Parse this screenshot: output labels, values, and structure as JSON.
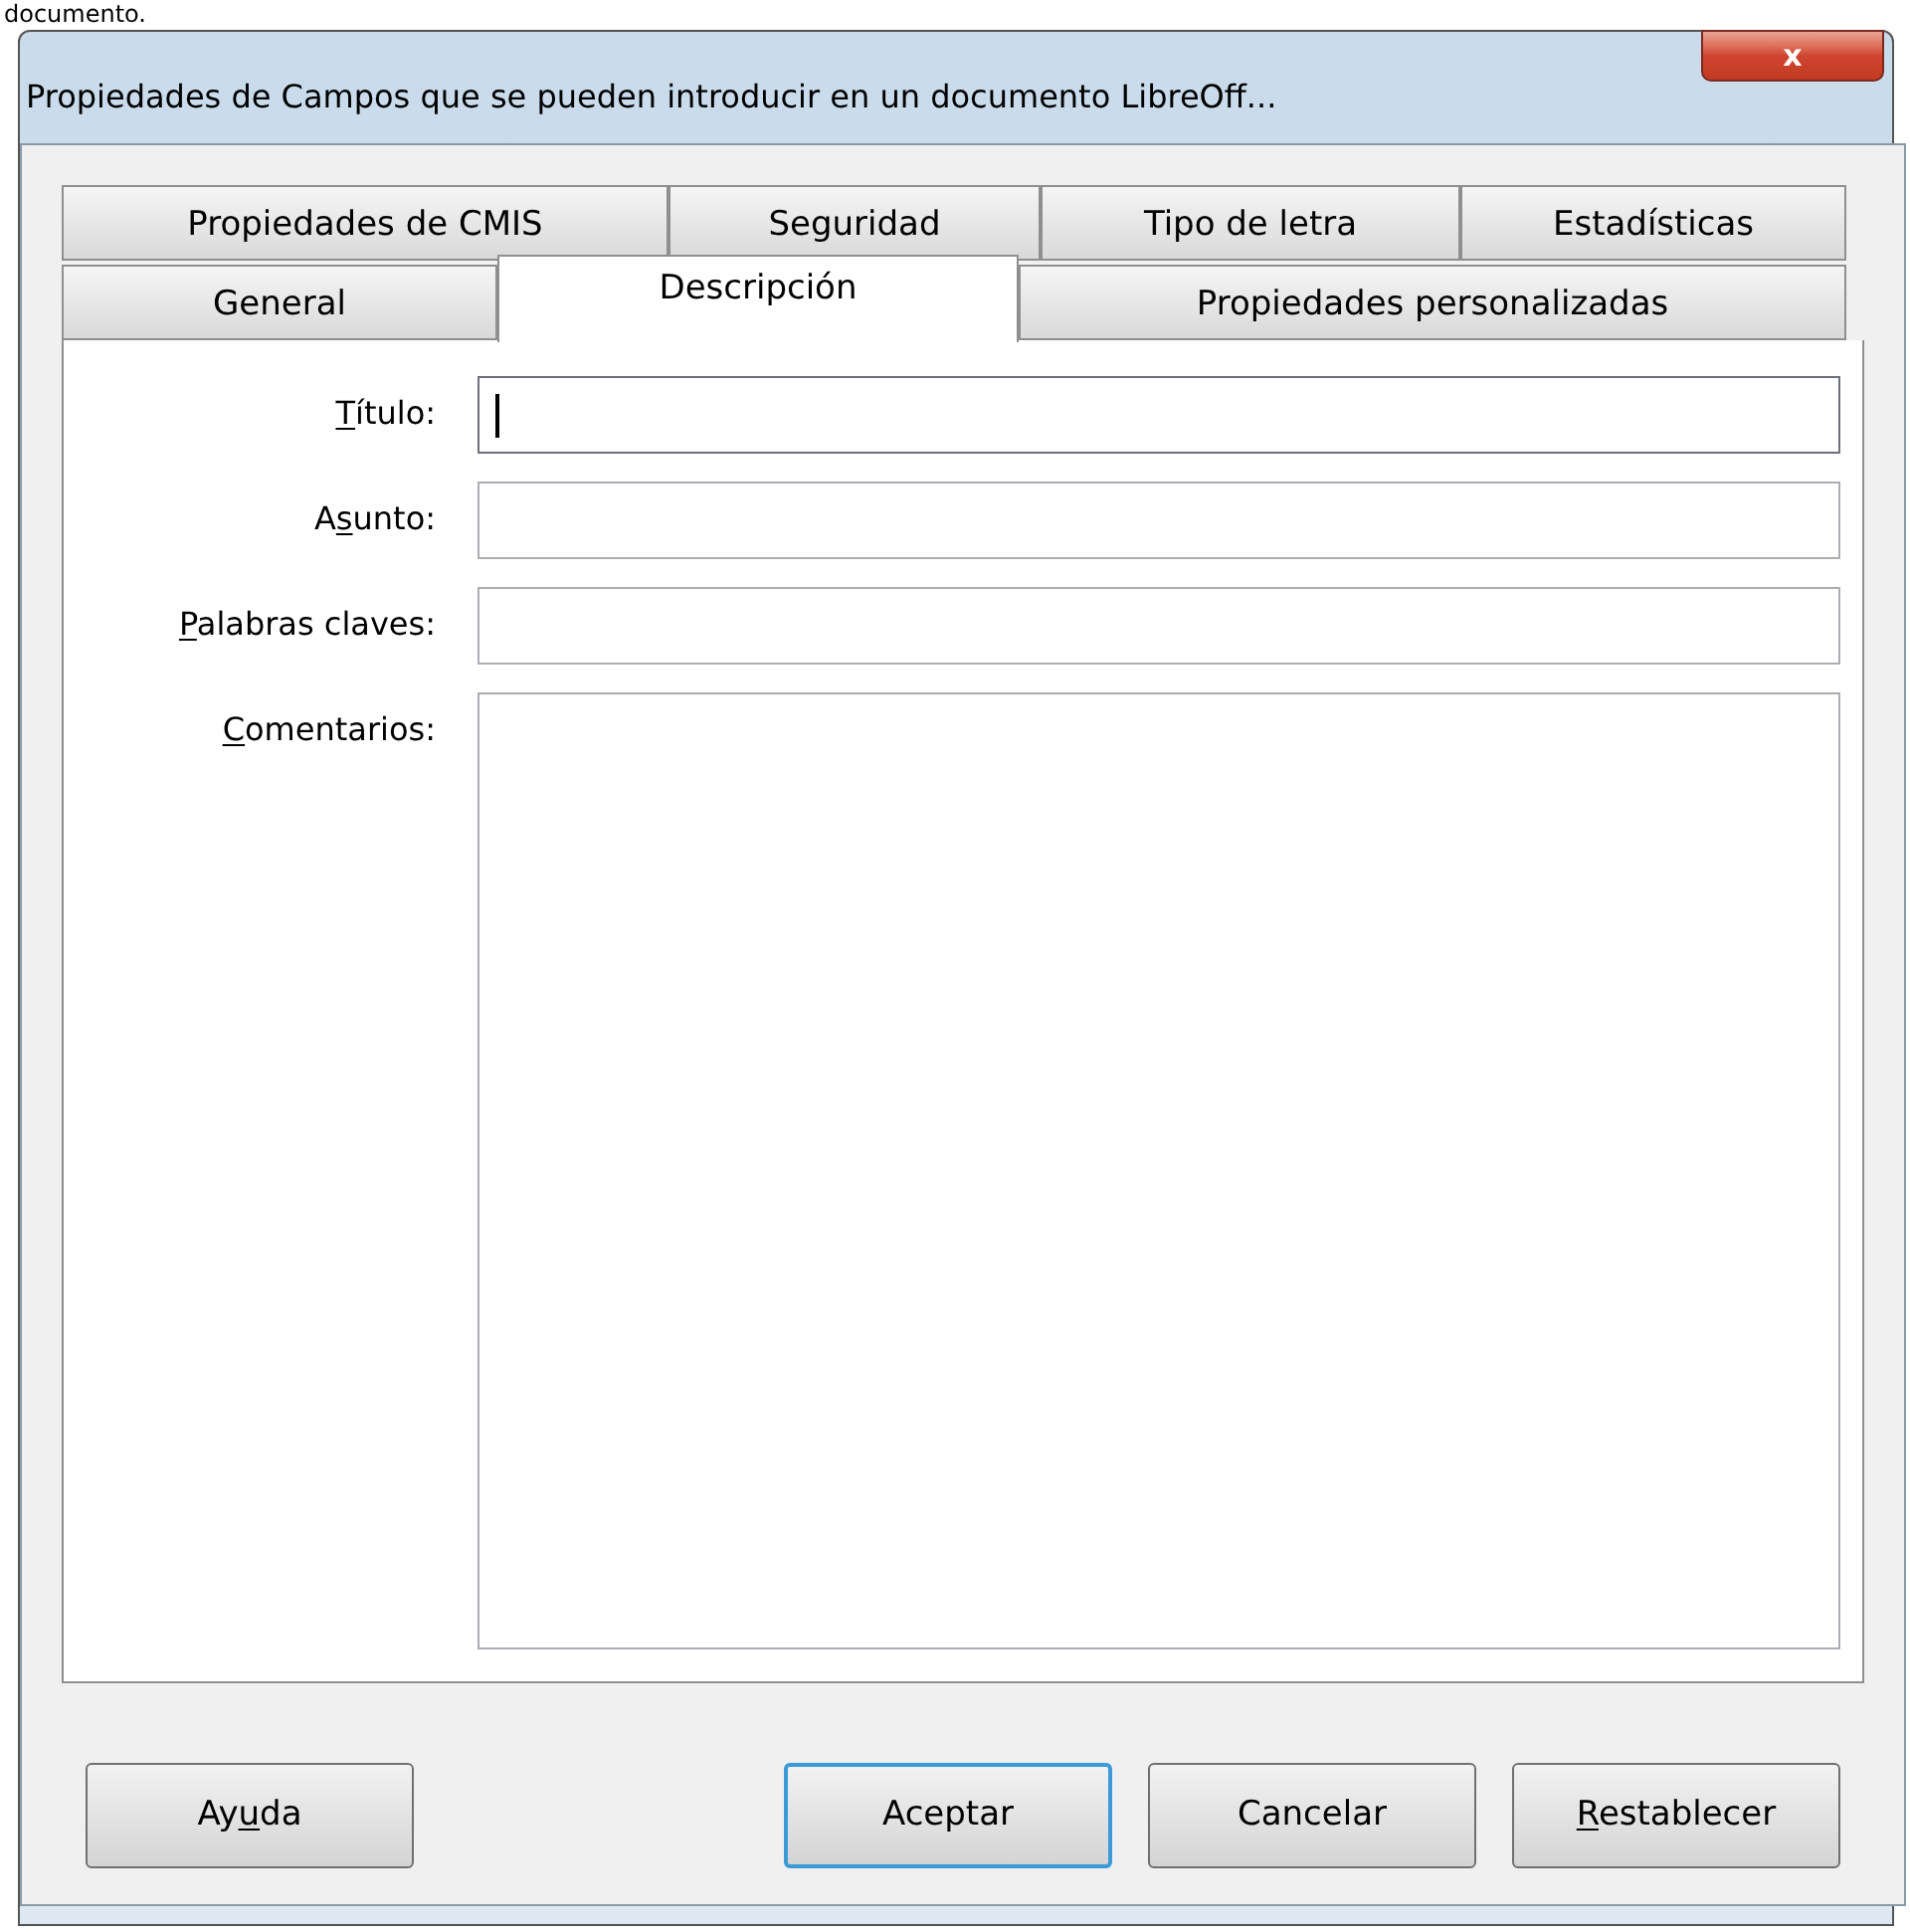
{
  "caption_above": "documento.",
  "window": {
    "title": "Propiedades de Campos que se pueden introducir en un documento LibreOff...",
    "close": "x"
  },
  "tab_rows": [
    [
      {
        "label": "Propiedades de CMIS",
        "selected": false
      },
      {
        "label": "Seguridad",
        "selected": false
      },
      {
        "label": "Tipo de letra",
        "selected": false
      },
      {
        "label": "Estadísticas",
        "selected": false
      }
    ],
    [
      {
        "label": "General",
        "selected": false
      },
      {
        "label": "Descripción",
        "selected": true
      },
      {
        "label": "Propiedades personalizadas",
        "selected": false
      }
    ]
  ],
  "fields": [
    {
      "kind": "line",
      "label": {
        "key": "T",
        "post": "ítulo:"
      },
      "focused": true
    },
    {
      "kind": "line",
      "label": {
        "pre": "A",
        "key": "s",
        "post": "unto:"
      },
      "focused": false
    },
    {
      "kind": "line",
      "label": {
        "key": "P",
        "post": "alabras claves:"
      },
      "focused": false
    },
    {
      "kind": "multiline",
      "label": {
        "key": "C",
        "post": "omentarios:"
      },
      "focused": false
    }
  ],
  "buttons": [
    {
      "label": {
        "pre": "Ay",
        "key": "u",
        "post": "da"
      },
      "default": false
    },
    {
      "label": {
        "pre": "Aceptar"
      },
      "default": true
    },
    {
      "label": {
        "pre": "Cancelar"
      },
      "default": false
    },
    {
      "label": {
        "key": "R",
        "post": "establecer"
      },
      "default": false
    }
  ]
}
